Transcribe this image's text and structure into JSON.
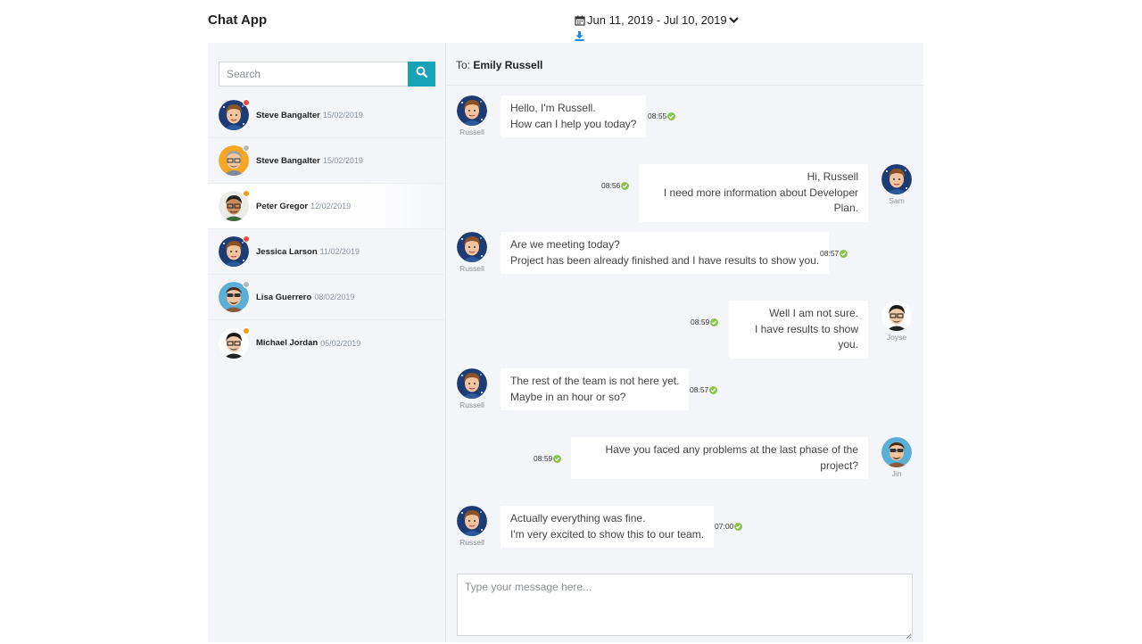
{
  "app": {
    "title": "Chat App"
  },
  "header": {
    "date_range": "Jun 11, 2019 - Jul 10, 2019",
    "calendar_icon": "calendar-icon",
    "dropdown_icon": "chevron-down-icon",
    "download_icon": "download-icon"
  },
  "sidebar": {
    "search": {
      "placeholder": "Search",
      "value": ""
    },
    "contacts": [
      {
        "name": "Steve Bangalter",
        "date": "15/02/2019",
        "status": "#e74c3c",
        "avatar": "a"
      },
      {
        "name": "Steve Bangalter",
        "date": "15/02/2019",
        "status": "#b0b8c4",
        "avatar": "b"
      },
      {
        "name": "Peter Gregor",
        "date": "12/02/2019",
        "status": "#f39c12",
        "avatar": "c"
      },
      {
        "name": "Jessica Larson",
        "date": "11/02/2019",
        "status": "#e74c3c",
        "avatar": "a"
      },
      {
        "name": "Lisa Guerrero",
        "date": "08/02/2019",
        "status": "#b0b8c4",
        "avatar": "d"
      },
      {
        "name": "Michael Jordan",
        "date": "05/02/2019",
        "status": "#f39c12",
        "avatar": "e"
      }
    ]
  },
  "chat": {
    "to_label": "To:",
    "to_name": "Emily Russell",
    "messages": [
      {
        "side": "left",
        "author": "Russell",
        "lines": [
          "Hello, I'm Russell.",
          "How can I help you today?"
        ],
        "time": "08:55"
      },
      {
        "side": "right",
        "author": "Sam",
        "lines": [
          "Hi, Russell",
          "I need more information about Developer Plan."
        ],
        "time": "08:56"
      },
      {
        "side": "left",
        "author": "Russell",
        "lines": [
          "Are we meeting today?",
          "Project has been already finished and I have results to show you."
        ],
        "time": "08:57"
      },
      {
        "side": "right",
        "author": "Joyse",
        "lines": [
          "Well I am not sure.",
          "I have results to show you."
        ],
        "time": "08:59"
      },
      {
        "side": "left",
        "author": "Russell",
        "lines": [
          "The rest of the team is not here yet.",
          "Maybe in an hour or so?"
        ],
        "time": "08:57"
      },
      {
        "side": "right",
        "author": "Jin",
        "lines": [
          "Have you faced any problems at the last phase of the project?"
        ],
        "time": "08:59"
      },
      {
        "side": "left",
        "author": "Russell",
        "lines": [
          "Actually everything was fine.",
          "I'm very excited to show this to our team."
        ],
        "time": "07:00"
      }
    ],
    "compose": {
      "placeholder": "Type your message here...",
      "value": ""
    }
  },
  "colors": {
    "accent": "#17a2b8",
    "read_tick": "#8bc34a",
    "download": "#1e88e5"
  }
}
